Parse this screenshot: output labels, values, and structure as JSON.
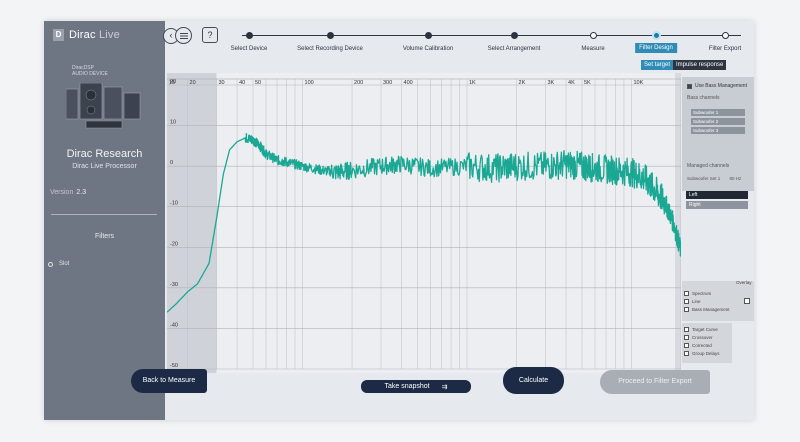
{
  "app": {
    "brand": "Dirac",
    "brand_suffix": "Live",
    "logo_letter": "D"
  },
  "sidebar": {
    "device_model_line1": "DiracDSP",
    "device_model_line2": "AUDIO DEVICE",
    "device_title": "Dirac Research",
    "device_subtitle": "Dirac Live Processor",
    "version_label": "Version",
    "version_value": "2.3",
    "filters_label": "Filters",
    "filter_items": [
      {
        "label": "Slot"
      }
    ]
  },
  "topbar": {
    "help_label": "?"
  },
  "steps": [
    {
      "label": "Select Device",
      "state": "done"
    },
    {
      "label": "Select Recording Device",
      "state": "done"
    },
    {
      "label": "Volume Calibration",
      "state": "done"
    },
    {
      "label": "Select Arrangement",
      "state": "done"
    },
    {
      "label": "Measure",
      "state": "hollow"
    },
    {
      "label": "Filter Design",
      "state": "active"
    },
    {
      "label": "Filter Export",
      "state": "todo"
    }
  ],
  "view_tabs": {
    "target": "Set target",
    "impulse": "Impulse response"
  },
  "chart_data": {
    "type": "line",
    "x_scale": "log",
    "xlim": [
      15,
      20000
    ],
    "ylim": [
      -50,
      20
    ],
    "x_tick_labels": [
      "15",
      "20",
      "30",
      "40",
      "50",
      "100",
      "200",
      "300",
      "400",
      "1K",
      "2K",
      "3K",
      "4K",
      "5K",
      "10K",
      "20K"
    ],
    "x_tick_values": [
      15,
      20,
      30,
      40,
      50,
      100,
      200,
      300,
      400,
      1000,
      2000,
      3000,
      4000,
      5000,
      10000,
      20000
    ],
    "y_tick_labels": [
      "20",
      "10",
      "0",
      "-10",
      "-20",
      "-30",
      "-40",
      "-50"
    ],
    "y_tick_values": [
      20,
      10,
      0,
      -10,
      -20,
      -30,
      -40,
      -50
    ],
    "series": [
      {
        "color": "#1aa894",
        "x": [
          15,
          17,
          20,
          23,
          27,
          30,
          33,
          36,
          40,
          45,
          50,
          55,
          60,
          70,
          80,
          100,
          130,
          160,
          200,
          300,
          400,
          600,
          1000,
          1500,
          2000,
          3000,
          4000,
          5000,
          6000,
          8000,
          10000,
          12000,
          14000,
          16000,
          18000,
          20000
        ],
        "y": [
          -36,
          -34,
          -31,
          -29,
          -24,
          -13,
          -2,
          4,
          6,
          7,
          6.5,
          5,
          3,
          1.5,
          1,
          0,
          -1,
          -1.5,
          -1,
          0,
          0.5,
          -0.5,
          0,
          -0.5,
          0,
          0,
          0.5,
          0,
          -0.5,
          -1,
          -1.5,
          -3,
          -6,
          -9,
          -14,
          -21
        ]
      }
    ]
  },
  "right_panel": {
    "bass_mgmt_label": "Use Bass Management",
    "bass_channels_label": "Bass channels",
    "subwoofers": [
      "Subwoofer 1",
      "Subwoofer 2",
      "Subwoofer 3"
    ],
    "managed_label": "Managed channels",
    "sub_row_label": "Subwoofer Set 1",
    "sub_row_value": "80 Hz",
    "channel_left": "Left",
    "channel_right": "Right",
    "overlay_label": "Overlay",
    "options_mid": [
      "Spectrum",
      "Line",
      "Bass Management"
    ],
    "options_bot": [
      "Target Curve",
      "Crossover",
      "Corrected",
      "Group Delays"
    ]
  },
  "bottom": {
    "back_label": "Back to Measure",
    "snapshot_label": "Take snapshot",
    "calculate_label": "Calculate",
    "export_label": "Proceed to Filter Export"
  }
}
